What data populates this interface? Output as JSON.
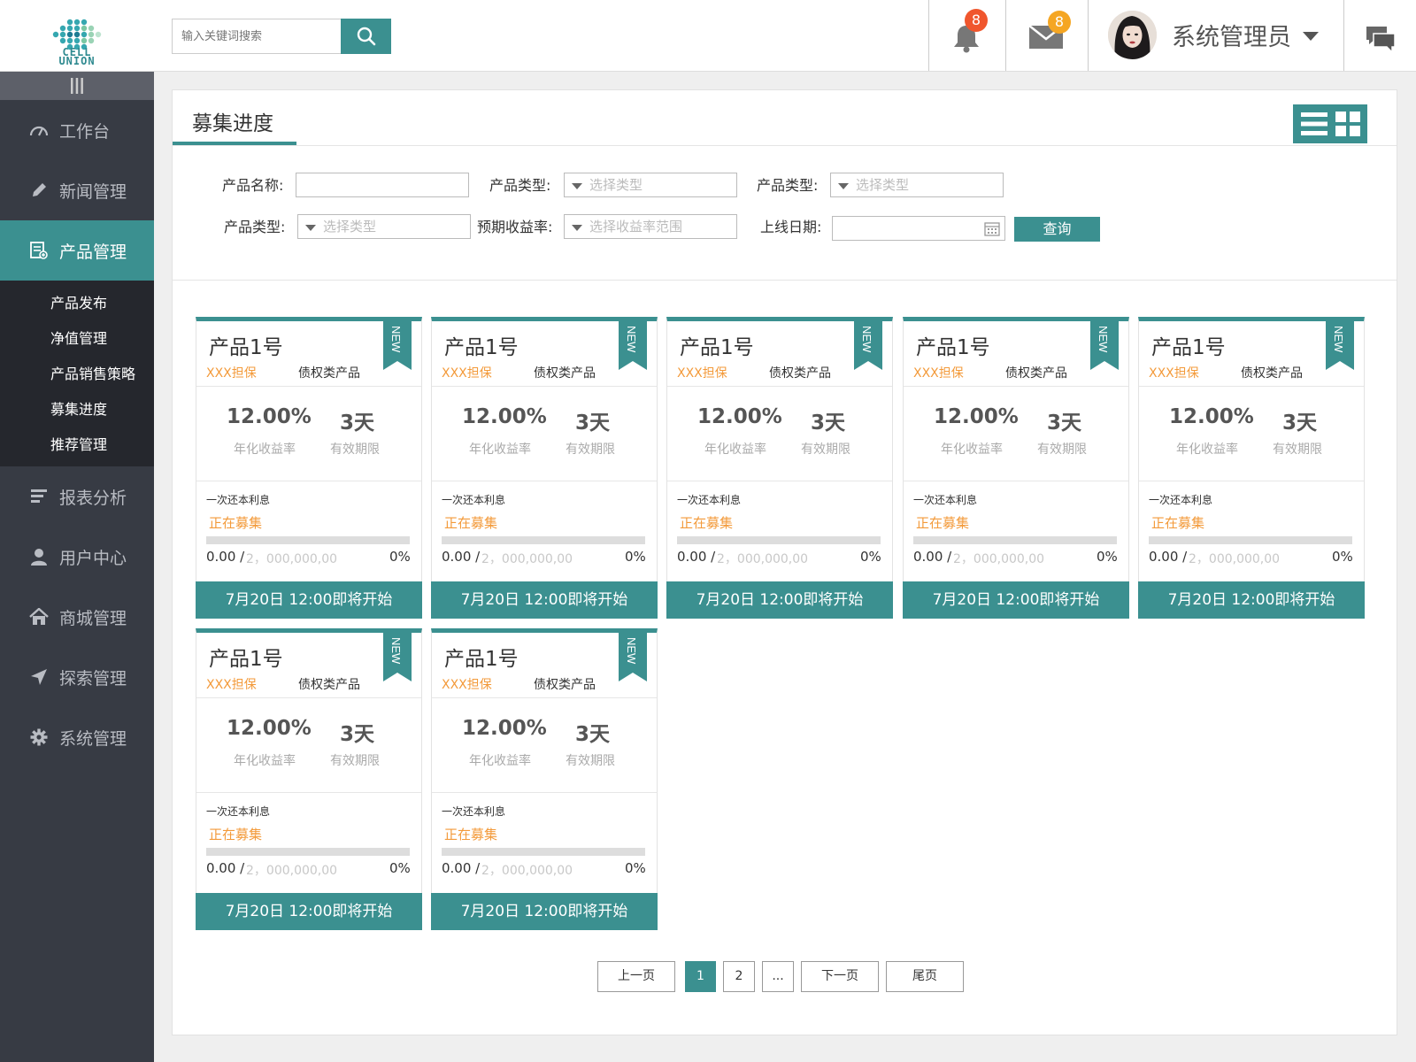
{
  "header": {
    "logo_text_line1": "CELL",
    "logo_text_line2": "UNION",
    "search_placeholder": "输入关键词搜索",
    "notifications_count": "8",
    "messages_count": "8",
    "user_name": "系统管理员"
  },
  "sidebar": {
    "items": [
      {
        "label": "工作台",
        "icon": "dashboard-icon"
      },
      {
        "label": "新闻管理",
        "icon": "pencil-icon"
      },
      {
        "label": "产品管理",
        "icon": "product-icon",
        "active": true
      },
      {
        "label": "报表分析",
        "icon": "report-icon"
      },
      {
        "label": "用户中心",
        "icon": "user-icon"
      },
      {
        "label": "商城管理",
        "icon": "home-icon"
      },
      {
        "label": "探索管理",
        "icon": "send-icon"
      },
      {
        "label": "系统管理",
        "icon": "gear-icon"
      }
    ],
    "sub_items": [
      "产品发布",
      "净值管理",
      "产品销售策略",
      "募集进度",
      "推荐管理"
    ]
  },
  "page": {
    "title": "募集进度"
  },
  "filters": {
    "product_name_label": "产品名称:",
    "product_type_label": "产品类型:",
    "type_placeholder": "选择类型",
    "expected_return_label": "预期收益率:",
    "return_placeholder": "选择收益率范围",
    "online_date_label": "上线日期:",
    "query_button": "查询"
  },
  "cards": [
    {
      "name": "产品1号",
      "guarantee": "XXX担保",
      "type": "债权类产品",
      "badge": "NEW",
      "rate": "12.00%",
      "rate_label": "年化收益率",
      "term": "3天",
      "term_label": "有效期限",
      "repay": "一次还本利息",
      "status": "正在募集",
      "raised": "0.00 /",
      "total": "2，000,000,00",
      "percent": "0%",
      "progress": 0,
      "start": "7月20日  12:00即将开始"
    },
    {
      "name": "产品1号",
      "guarantee": "XXX担保",
      "type": "债权类产品",
      "badge": "NEW",
      "rate": "12.00%",
      "rate_label": "年化收益率",
      "term": "3天",
      "term_label": "有效期限",
      "repay": "一次还本利息",
      "status": "正在募集",
      "raised": "0.00 /",
      "total": "2，000,000,00",
      "percent": "0%",
      "progress": 0,
      "start": "7月20日  12:00即将开始"
    },
    {
      "name": "产品1号",
      "guarantee": "XXX担保",
      "type": "债权类产品",
      "badge": "NEW",
      "rate": "12.00%",
      "rate_label": "年化收益率",
      "term": "3天",
      "term_label": "有效期限",
      "repay": "一次还本利息",
      "status": "正在募集",
      "raised": "0.00 /",
      "total": "2，000,000,00",
      "percent": "0%",
      "progress": 0,
      "start": "7月20日  12:00即将开始"
    },
    {
      "name": "产品1号",
      "guarantee": "XXX担保",
      "type": "债权类产品",
      "badge": "NEW",
      "rate": "12.00%",
      "rate_label": "年化收益率",
      "term": "3天",
      "term_label": "有效期限",
      "repay": "一次还本利息",
      "status": "正在募集",
      "raised": "0.00 /",
      "total": "2，000,000,00",
      "percent": "0%",
      "progress": 0,
      "start": "7月20日  12:00即将开始"
    },
    {
      "name": "产品1号",
      "guarantee": "XXX担保",
      "type": "债权类产品",
      "badge": "NEW",
      "rate": "12.00%",
      "rate_label": "年化收益率",
      "term": "3天",
      "term_label": "有效期限",
      "repay": "一次还本利息",
      "status": "正在募集",
      "raised": "0.00 /",
      "total": "2，000,000,00",
      "percent": "0%",
      "progress": 0,
      "start": "7月20日  12:00即将开始"
    },
    {
      "name": "产品1号",
      "guarantee": "XXX担保",
      "type": "债权类产品",
      "badge": "NEW",
      "rate": "12.00%",
      "rate_label": "年化收益率",
      "term": "3天",
      "term_label": "有效期限",
      "repay": "一次还本利息",
      "status": "正在募集",
      "raised": "0.00 /",
      "total": "2，000,000,00",
      "percent": "0%",
      "progress": 0,
      "start": "7月20日  12:00即将开始"
    },
    {
      "name": "产品1号",
      "guarantee": "XXX担保",
      "type": "债权类产品",
      "badge": "NEW",
      "rate": "12.00%",
      "rate_label": "年化收益率",
      "term": "3天",
      "term_label": "有效期限",
      "repay": "一次还本利息",
      "status": "正在募集",
      "raised": "0.00 /",
      "total": "2，000,000,00",
      "percent": "0%",
      "progress": 0,
      "start": "7月20日  12:00即将开始"
    }
  ],
  "pagination": {
    "prev": "上一页",
    "pages": [
      "1",
      "2",
      "..."
    ],
    "current": "1",
    "next": "下一页",
    "last": "尾页"
  },
  "colors": {
    "accent": "#3b9090",
    "sidebar_bg": "#373b44",
    "highlight_orange": "#f39a3a",
    "badge_red": "#f0562d",
    "badge_orange": "#f5a623"
  }
}
